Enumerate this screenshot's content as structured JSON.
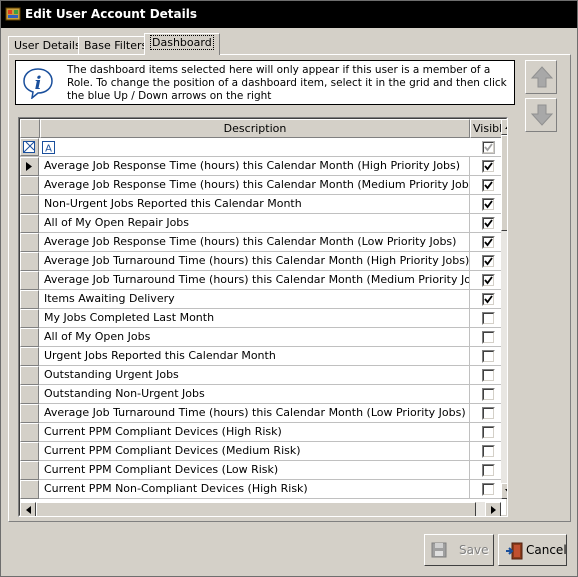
{
  "window": {
    "title": "Edit User Account Details"
  },
  "tabs": [
    {
      "label": "User Details",
      "active": false
    },
    {
      "label": "Base Filters",
      "active": false
    },
    {
      "label": "Dashboard",
      "active": true
    }
  ],
  "info": {
    "text": "The dashboard items selected here will only appear if this user is a member of a Role. To change the position of a dashboard item, select it in the grid and then click the blue Up / Down arrows on the right"
  },
  "grid": {
    "columns": {
      "description": "Description",
      "visible": "Visible"
    },
    "rows": [
      {
        "description": "Average Job Response Time (hours) this Calendar Month (High Priority Jobs)",
        "visible": true,
        "current": true
      },
      {
        "description": "Average Job  Response Time (hours) this Calendar Month (Medium Priority Jobs)",
        "visible": true
      },
      {
        "description": "Non-Urgent Jobs Reported this Calendar Month",
        "visible": true
      },
      {
        "description": "All of My Open Repair Jobs",
        "visible": true
      },
      {
        "description": "Average Job  Response Time (hours) this Calendar Month (Low Priority Jobs)",
        "visible": true
      },
      {
        "description": "Average Job  Turnaround Time (hours) this Calendar Month (High Priority Jobs)",
        "visible": true
      },
      {
        "description": "Average Job Turnaround Time (hours) this Calendar Month (Medium Priority Jobs)",
        "visible": true
      },
      {
        "description": "Items Awaiting Delivery",
        "visible": true
      },
      {
        "description": "My Jobs Completed Last Month",
        "visible": false
      },
      {
        "description": "All of My Open Jobs",
        "visible": false
      },
      {
        "description": "Urgent Jobs Reported this Calendar Month",
        "visible": false
      },
      {
        "description": "Outstanding Urgent Jobs",
        "visible": false
      },
      {
        "description": "Outstanding Non-Urgent Jobs",
        "visible": false
      },
      {
        "description": "Average Job Turnaround Time (hours) this Calendar Month (Low Priority Jobs)",
        "visible": false
      },
      {
        "description": "Current PPM Compliant Devices (High Risk)",
        "visible": false
      },
      {
        "description": "Current PPM  Compliant Devices (Medium Risk)",
        "visible": false
      },
      {
        "description": "Current PPM Compliant Devices (Low Risk)",
        "visible": false
      },
      {
        "description": "Current PPM Non-Compliant Devices (High Risk)",
        "visible": false
      }
    ]
  },
  "buttons": {
    "save": "Save",
    "save_enabled": false,
    "cancel": "Cancel"
  },
  "icons": {
    "title": "app-icon",
    "info": "info-icon",
    "move_up": "arrow-up-icon",
    "move_down": "arrow-down-icon",
    "save": "floppy-disk-icon",
    "cancel": "exit-door-icon"
  }
}
